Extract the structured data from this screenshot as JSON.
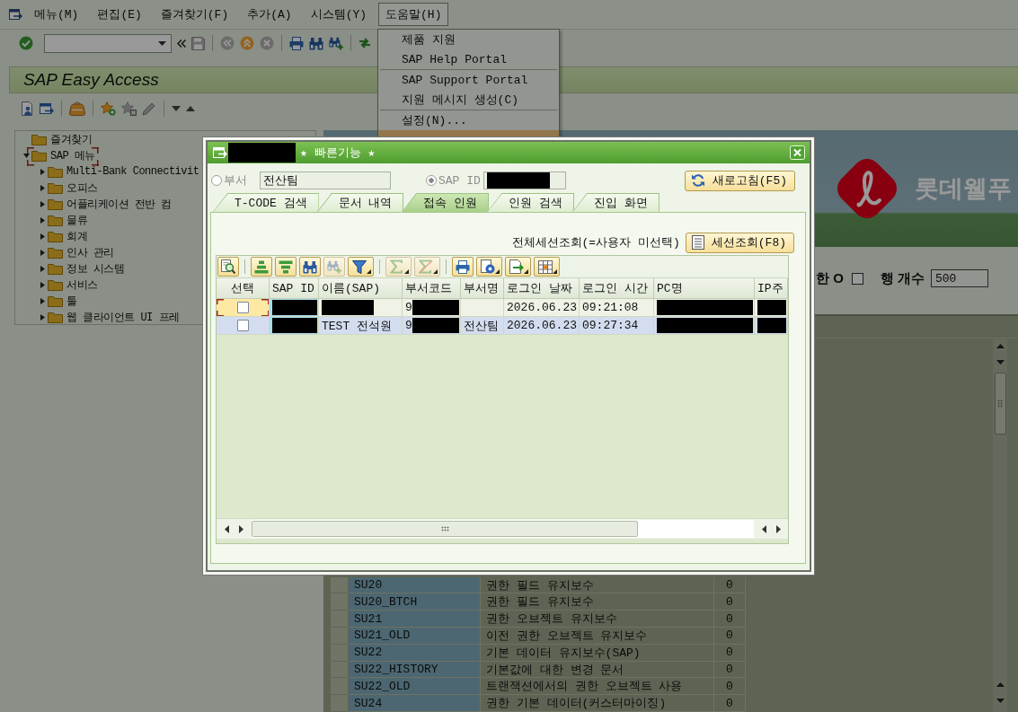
{
  "menu_bar": {
    "items": [
      {
        "label": "메뉴(M)",
        "selected": false
      },
      {
        "label": "편집(E)",
        "selected": false
      },
      {
        "label": "즐겨찾기(F)",
        "selected": false
      },
      {
        "label": "추가(A)",
        "selected": false
      },
      {
        "label": "시스템(Y)",
        "selected": false
      },
      {
        "label": "도움말(H)",
        "selected": true
      }
    ]
  },
  "help_menu": {
    "items": [
      {
        "kind": "item",
        "label": "제품 지원",
        "selected": false
      },
      {
        "kind": "item",
        "label": "SAP Help Portal",
        "selected": false
      },
      {
        "kind": "separator"
      },
      {
        "kind": "item",
        "label": "SAP Support Portal",
        "selected": false
      },
      {
        "kind": "item",
        "label": "지원 메시지 생성(C)",
        "selected": false
      },
      {
        "kind": "separator"
      },
      {
        "kind": "item",
        "label": "설정(N)...",
        "selected": false
      },
      {
        "kind": "item",
        "selected": true
      }
    ]
  },
  "toolbar": {
    "buttons": [
      {
        "disabled": false
      },
      {
        "disabled": true
      },
      {
        "disabled": true
      },
      {
        "disabled": false
      },
      {
        "disabled": true
      },
      {
        "disabled": false
      },
      {
        "disabled": false
      },
      {
        "disabled": false
      },
      {
        "disabled": false
      }
    ]
  },
  "easy_access": {
    "title": "SAP Easy Access",
    "buttons": [
      {
        "disabled": false
      },
      {
        "disabled": false
      },
      {
        "disabled": false
      },
      {
        "disabled": false
      },
      {
        "disabled": true
      },
      {
        "disabled": true
      },
      {
        "disabled": false
      },
      {
        "disabled": false
      }
    ]
  },
  "tree": {
    "items": [
      {
        "label": "즐겨찾기",
        "focused": false
      },
      {
        "label": "SAP 메뉴",
        "expanded": true,
        "focused": true,
        "children": [
          {
            "label": "Multi-Bank Connectivit",
            "expanded": false,
            "focused": false
          },
          {
            "label": "오피스",
            "expanded": false,
            "focused": false
          },
          {
            "label": "어플리케이션 전반 컴",
            "expanded": false,
            "focused": false
          },
          {
            "label": "물류",
            "expanded": false,
            "focused": false
          },
          {
            "label": "회계",
            "expanded": false,
            "focused": false
          },
          {
            "label": "인사 관리",
            "expanded": false,
            "focused": false
          },
          {
            "label": "정보 시스템",
            "expanded": false,
            "focused": false
          },
          {
            "label": "서비스",
            "expanded": false,
            "focused": false
          },
          {
            "label": "툴",
            "expanded": false,
            "focused": false
          },
          {
            "label": "웹 클라이언트 UI 프레",
            "expanded": false,
            "focused": false
          }
        ]
      }
    ]
  },
  "banner": {
    "text": "롯데웰푸"
  },
  "filter": {
    "label": "한 O",
    "checked": false,
    "row_count_label": "행 개수",
    "row_count": "500"
  },
  "table": {
    "rows": [
      {
        "cells": [
          "SU20",
          "권한 필드 유지보수",
          "0"
        ]
      },
      {
        "cells": [
          "SU20_BTCH",
          "권한 필드 유지보수",
          "0"
        ]
      },
      {
        "cells": [
          "SU21",
          "권한 오브젝트 유지보수",
          "0"
        ]
      },
      {
        "cells": [
          "SU21_OLD",
          "이전 권한 오브젝트 유지보수",
          "0"
        ]
      },
      {
        "cells": [
          "SU22",
          "기본 데이터 유지보수(SAP)",
          "0"
        ]
      },
      {
        "cells": [
          "SU22_HISTORY",
          "기본값에 대한 변경 문서",
          "0"
        ]
      },
      {
        "cells": [
          "SU22_OLD",
          "트랜잭션에서의 권한 오브젝트 사용",
          "0"
        ]
      },
      {
        "cells": [
          "SU24",
          "권한 기본 데이터(커스터마이징)",
          "0"
        ]
      }
    ]
  },
  "dialog": {
    "title": "★ 빠른기능 ★",
    "title_redacted": true,
    "options": [
      {
        "label": "부서",
        "selected": false,
        "disabled": true,
        "value": "전산팀",
        "redacted": false
      },
      {
        "label": "SAP ID",
        "selected": true,
        "disabled": true,
        "redacted": true
      }
    ],
    "refresh_button": "새로고침(F5)",
    "tabs": [
      {
        "label": "T-CODE 검색",
        "selected": false
      },
      {
        "label": "문서 내역",
        "selected": false
      },
      {
        "label": "접속 인원",
        "selected": true
      },
      {
        "label": "인원 검색",
        "selected": false
      },
      {
        "label": "진입 화면",
        "selected": false
      }
    ],
    "session_hint": "전체세션조회(=사용자 미선택)",
    "session_button": "세션조회(F8)",
    "grid": {
      "toolbar": [
        {
          "disabled": false
        },
        {
          "disabled": false
        },
        {
          "disabled": false
        },
        {
          "disabled": false
        },
        {
          "disabled": true
        },
        {
          "disabled": false
        },
        {
          "disabled": true
        },
        {
          "disabled": true
        },
        {
          "disabled": false
        },
        {
          "disabled": false
        },
        {
          "disabled": false
        },
        {
          "disabled": false
        }
      ],
      "columns": [
        "선택",
        "SAP ID",
        "이름(SAP)",
        "부서코드",
        "부서명",
        "로그인 날짜",
        "로그인 시간",
        "PC명",
        "IP주"
      ],
      "rows": [
        {
          "selected": false,
          "focused": true,
          "cells": [
            {
              "kind": "checkbox",
              "checked": false
            },
            {
              "kind": "text",
              "redacted": true
            },
            {
              "kind": "text",
              "redacted": true
            },
            {
              "kind": "text",
              "text": "9",
              "redacted": true
            },
            {
              "kind": "text",
              "redacted": false
            },
            {
              "kind": "text",
              "text": "2026.06.23",
              "redacted": false
            },
            {
              "kind": "text",
              "text": "09:21:08",
              "redacted": false
            },
            {
              "kind": "text",
              "redacted": true
            },
            {
              "kind": "text",
              "redacted": true
            }
          ]
        },
        {
          "selected": true,
          "focused": false,
          "cells": [
            {
              "kind": "checkbox",
              "checked": false
            },
            {
              "kind": "text",
              "redacted": true
            },
            {
              "kind": "text",
              "text": "TEST 전석원",
              "redacted": false
            },
            {
              "kind": "text",
              "text": "9",
              "redacted": true
            },
            {
              "kind": "text",
              "text": "전산팀",
              "redacted": false
            },
            {
              "kind": "text",
              "text": "2026.06.23",
              "redacted": false
            },
            {
              "kind": "text",
              "text": "09:27:34",
              "redacted": false
            },
            {
              "kind": "text",
              "redacted": true
            },
            {
              "kind": "text",
              "redacted": true
            }
          ]
        }
      ]
    }
  }
}
